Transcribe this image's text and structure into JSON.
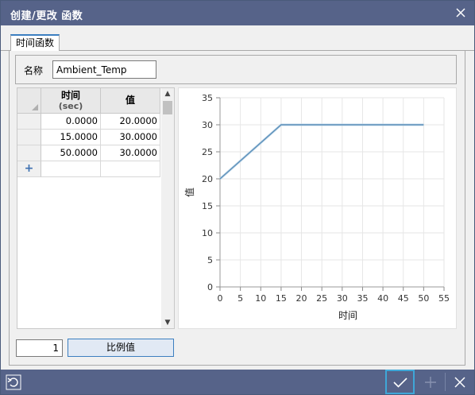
{
  "window": {
    "title": "创建/更改 函数"
  },
  "tabs": [
    {
      "label": "时间函数"
    }
  ],
  "name_field": {
    "label": "名称",
    "value": "Ambient_Temp"
  },
  "table": {
    "columns": [
      {
        "label": "时间",
        "sub": "(sec)"
      },
      {
        "label": "值",
        "sub": ""
      }
    ],
    "rows": [
      [
        "0.0000",
        "20.0000"
      ],
      [
        "15.0000",
        "30.0000"
      ],
      [
        "50.0000",
        "30.0000"
      ]
    ],
    "add_row_symbol": "+"
  },
  "chart_data": {
    "type": "line",
    "xlabel": "时间",
    "ylabel": "值",
    "xlim": [
      0,
      55
    ],
    "ylim": [
      0,
      35
    ],
    "xticks": [
      0,
      5,
      10,
      15,
      20,
      25,
      30,
      35,
      40,
      45,
      50,
      55
    ],
    "yticks": [
      0,
      5,
      10,
      15,
      20,
      25,
      30,
      35
    ],
    "grid": true,
    "series": [
      {
        "x": [
          0,
          15,
          50
        ],
        "y": [
          20,
          30,
          30
        ],
        "color": "#5b8fb9"
      }
    ]
  },
  "scale": {
    "value": "1",
    "button_label": "比例值"
  },
  "bottombar": {
    "icons": [
      "reset-icon",
      "check-icon",
      "plus-icon",
      "close-icon"
    ]
  },
  "colors": {
    "titlebar": "#566389",
    "accent": "#3c7fc0",
    "line": "#5b8fb9"
  }
}
